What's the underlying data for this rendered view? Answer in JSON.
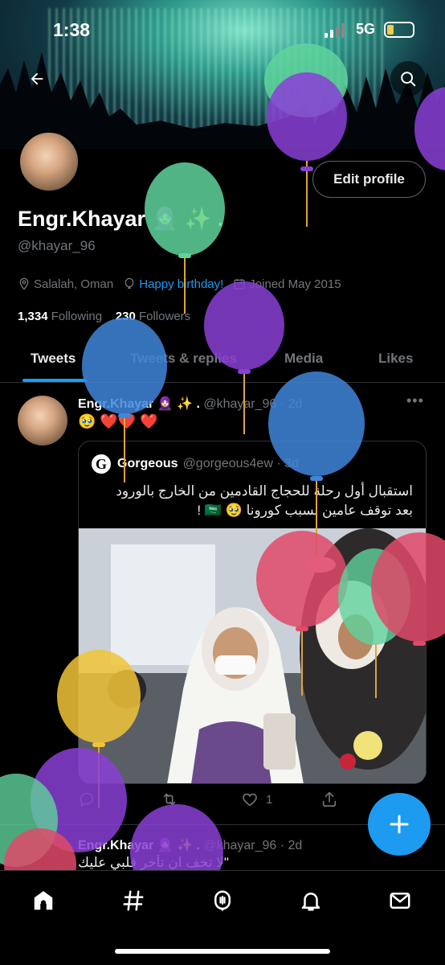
{
  "status_bar": {
    "time": "1:38",
    "network": "5G",
    "battery_fraction": 0.25,
    "battery_color": "#f7c948"
  },
  "header": {
    "back_icon": "back-arrow-icon",
    "search_icon": "search-icon"
  },
  "profile": {
    "display_name": "Engr.Khayar 🧕🏻 ✨ .",
    "handle": "@khayar_96",
    "edit_label": "Edit profile",
    "location": "Salalah, Oman",
    "website": "Happy birthday!",
    "joined": "Joined May 2015",
    "following_count": "1,334",
    "following_label": "Following",
    "followers_count": "230",
    "followers_label": "Followers"
  },
  "tabs": [
    {
      "label": "Tweets",
      "active": true
    },
    {
      "label": "Tweets & replies",
      "active": false
    },
    {
      "label": "Media",
      "active": false
    },
    {
      "label": "Likes",
      "active": false
    }
  ],
  "tweet": {
    "name": "Engr.Khayar 🧕🏻 ✨ .",
    "handle": "@khayar_96 · 2d",
    "text": "🥹 ❤️❤️ ❤️",
    "quote": {
      "logo_letter": "G",
      "name": "Gorgeous",
      "handle": "@gorgeous4ew · 3d",
      "line1": "استقبال أول رحلة للحجاج القادمين من الخارج بالورود",
      "line2": "بعد توقف عامين بسبب كورونا 🥹 🇸🇦 !"
    },
    "actions": {
      "reply_count": "",
      "retweet_count": "",
      "like_count": "1"
    }
  },
  "tweet2": {
    "name": "Engr.Khayar 🧕🏻 ✨ .",
    "handle": "@khayar_96 · 2d",
    "text": "\"لا تخف ان تأخر قلبي عليك"
  },
  "accent_color": "#1d9bf0",
  "bottom_nav": [
    {
      "icon": "home-icon"
    },
    {
      "icon": "hashtag-explore-icon"
    },
    {
      "icon": "spaces-microphone-icon"
    },
    {
      "icon": "notifications-bell-icon"
    },
    {
      "icon": "messages-envelope-icon"
    }
  ]
}
